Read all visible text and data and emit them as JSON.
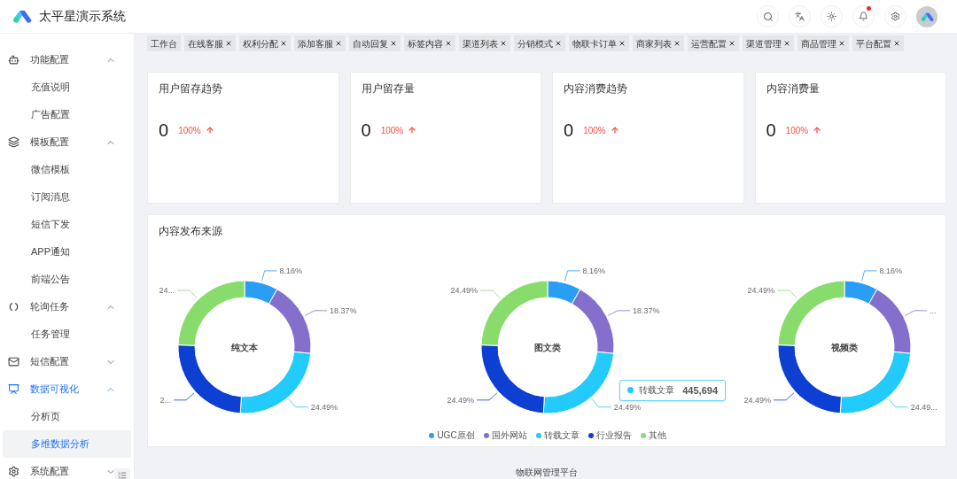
{
  "header": {
    "title": "太平星演示系统",
    "notification_dot": true
  },
  "sidebar": {
    "items": [
      {
        "label": "功能配置",
        "kind": "bot",
        "expanded": true,
        "active": false,
        "children": [
          {
            "label": "充值说明",
            "selected": false
          },
          {
            "label": "广告配置",
            "selected": false
          }
        ]
      },
      {
        "label": "模板配置",
        "kind": "layers",
        "expanded": true,
        "active": false,
        "children": [
          {
            "label": "微信模板",
            "selected": false
          },
          {
            "label": "订阅消息",
            "selected": false
          },
          {
            "label": "短信下发",
            "selected": false
          },
          {
            "label": "APP通知",
            "selected": false
          },
          {
            "label": "前端公告",
            "selected": false
          }
        ]
      },
      {
        "label": "轮询任务",
        "kind": "loop",
        "expanded": true,
        "active": false,
        "children": [
          {
            "label": "任务管理",
            "selected": false
          }
        ]
      },
      {
        "label": "短信配置",
        "kind": "mail",
        "expanded": false,
        "active": false
      },
      {
        "label": "数据可视化",
        "kind": "monitor",
        "expanded": true,
        "active": true,
        "children": [
          {
            "label": "分析页",
            "selected": false
          },
          {
            "label": "多维数据分析",
            "selected": true
          }
        ]
      },
      {
        "label": "系统配置",
        "kind": "gear",
        "expanded": false,
        "active": false
      }
    ]
  },
  "tabs": [
    {
      "label": "工作台",
      "closable": false
    },
    {
      "label": "在线客服",
      "closable": true
    },
    {
      "label": "权利分配",
      "closable": true
    },
    {
      "label": "添加客服",
      "closable": true
    },
    {
      "label": "自动回复",
      "closable": true
    },
    {
      "label": "标签内容",
      "closable": true
    },
    {
      "label": "渠道列表",
      "closable": true
    },
    {
      "label": "分销模式",
      "closable": true
    },
    {
      "label": "物联卡订单",
      "closable": true
    },
    {
      "label": "商家列表",
      "closable": true
    },
    {
      "label": "运营配置",
      "closable": true
    },
    {
      "label": "渠道管理",
      "closable": true
    },
    {
      "label": "商品管理",
      "closable": true
    },
    {
      "label": "平台配置",
      "closable": true
    }
  ],
  "stat_cards": [
    {
      "title": "用户留存趋势",
      "value": "0",
      "change": "100%",
      "kind": "rise"
    },
    {
      "title": "用户留存量",
      "value": "0",
      "change": "100%",
      "kind": "rise"
    },
    {
      "title": "内容消费趋势",
      "value": "0",
      "change": "100%",
      "kind": "rise"
    },
    {
      "title": "内容消费量",
      "value": "0",
      "change": "100%",
      "kind": "rise"
    }
  ],
  "source_panel": {
    "title": "内容发布来源",
    "charts": [
      {
        "chart_data": {
          "type": "donut",
          "title": "纯文本",
          "values": [
            8.16,
            18.37,
            24.49,
            24.49,
            24.49
          ],
          "value_labels": [
            "8.16%",
            "18.37%",
            "24.49%",
            "2...",
            "24..."
          ]
        }
      },
      {
        "chart_data": {
          "type": "donut",
          "title": "图文类",
          "values": [
            8.16,
            18.37,
            24.49,
            24.49,
            24.49
          ],
          "value_labels": [
            "8.16%",
            "18.37%",
            "24.49%",
            "24.49%",
            "24.49%"
          ]
        }
      },
      {
        "chart_data": {
          "type": "donut",
          "title": "视频类",
          "values": [
            8.16,
            18.37,
            24.49,
            24.49,
            24.49
          ],
          "value_labels": [
            "8.16%",
            "...",
            "24.49...",
            "24.49%",
            "24.49%"
          ]
        }
      }
    ],
    "legend": [
      {
        "label": "UGC原创",
        "color": "#2a9df4"
      },
      {
        "label": "国外网站",
        "color": "#8470cc"
      },
      {
        "label": "转载文章",
        "color": "#22cbfb"
      },
      {
        "label": "行业报告",
        "color": "#0d3fd3"
      },
      {
        "label": "其他",
        "color": "#88dc6c"
      }
    ],
    "tooltip": {
      "label": "转载文章",
      "value": "445,694",
      "color": "#22cbfb"
    }
  },
  "footer": {
    "text": "物联网管理平台"
  }
}
